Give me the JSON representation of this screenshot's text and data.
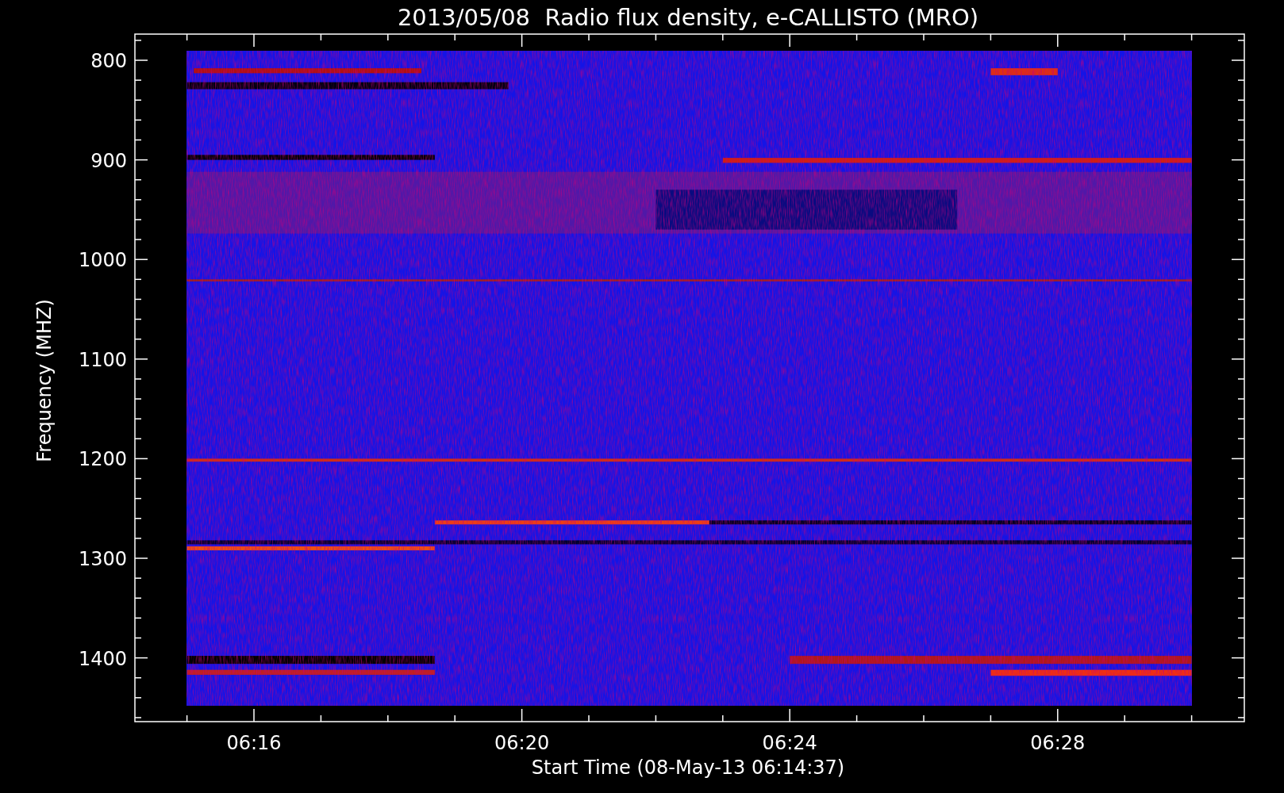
{
  "title": "2013/05/08  Radio flux density, e-CALLISTO (MRO)",
  "y_axis": {
    "label": "Frequency (MHZ)",
    "ticks": [
      "800",
      "900",
      "1000",
      "1100",
      "1200",
      "1300",
      "1400"
    ]
  },
  "x_axis": {
    "label": "Start Time (08-May-13 06:14:37)",
    "ticks": [
      "06:16",
      "06:20",
      "06:24",
      "06:28"
    ]
  }
}
